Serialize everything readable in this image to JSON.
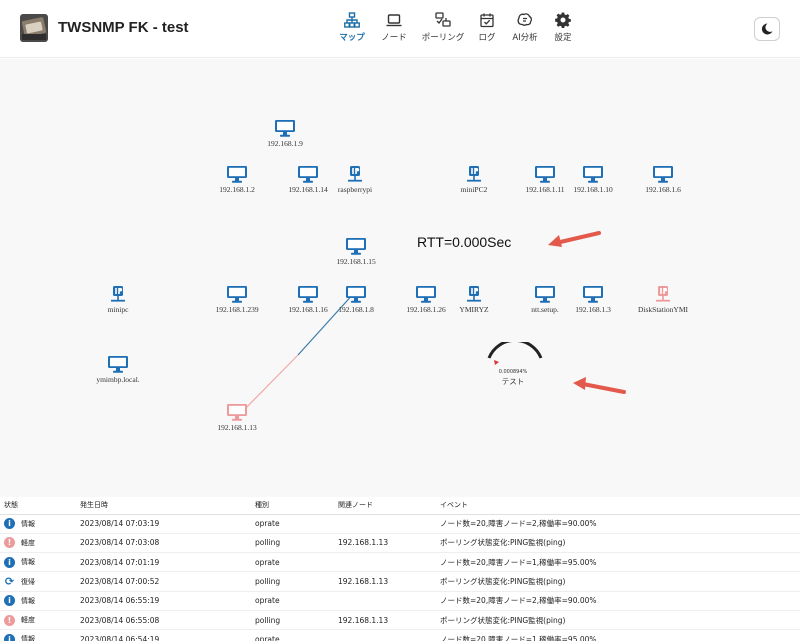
{
  "app": {
    "title": "TWSNMP FK - test"
  },
  "nav": [
    {
      "label": "マップ",
      "icon": "network-map-icon",
      "active": true
    },
    {
      "label": "ノード",
      "icon": "laptop-icon",
      "active": false
    },
    {
      "label": "ポーリング",
      "icon": "polling-icon",
      "active": false
    },
    {
      "label": "ログ",
      "icon": "calendar-check-icon",
      "active": false
    },
    {
      "label": "AI分析",
      "icon": "ai-brain-icon",
      "active": false
    },
    {
      "label": "設定",
      "icon": "gear-icon",
      "active": false
    }
  ],
  "theme_toggle_icon": "moon-icon",
  "colors": {
    "normal": "#1e6fb5",
    "low": "#ef9a9a",
    "alert_arrow": "#e35a4c"
  },
  "map": {
    "nodes": [
      {
        "label": "192.168.1.9",
        "icon": "desktop-icon",
        "state": "normal"
      },
      {
        "label": "192.168.1.2",
        "icon": "desktop-icon",
        "state": "normal"
      },
      {
        "label": "192.168.1.14",
        "icon": "desktop-icon",
        "state": "normal"
      },
      {
        "label": "raspberrypi",
        "icon": "ip-icon",
        "state": "normal"
      },
      {
        "label": "miniPC2",
        "icon": "ip-icon",
        "state": "normal"
      },
      {
        "label": "192.168.1.11",
        "icon": "desktop-icon",
        "state": "normal"
      },
      {
        "label": "192.168.1.10",
        "icon": "desktop-icon",
        "state": "normal"
      },
      {
        "label": "192.168.1.6",
        "icon": "desktop-icon",
        "state": "normal"
      },
      {
        "label": "192.168.1.15",
        "icon": "desktop-icon",
        "state": "normal"
      },
      {
        "label": "minipc",
        "icon": "ip-icon",
        "state": "normal"
      },
      {
        "label": "192.168.1.239",
        "icon": "desktop-icon",
        "state": "normal"
      },
      {
        "label": "192.168.1.16",
        "icon": "desktop-icon",
        "state": "normal"
      },
      {
        "label": "192.168.1.8",
        "icon": "desktop-icon",
        "state": "normal"
      },
      {
        "label": "192.168.1.26",
        "icon": "desktop-icon",
        "state": "normal"
      },
      {
        "label": "YMIRYZ",
        "icon": "ip-icon",
        "state": "normal"
      },
      {
        "label": "ntt.setup.",
        "icon": "desktop-icon",
        "state": "normal"
      },
      {
        "label": "192.168.1.3",
        "icon": "desktop-icon",
        "state": "normal"
      },
      {
        "label": "DiskStationYMI",
        "icon": "ip-icon",
        "state": "low"
      },
      {
        "label": "ymimbp.local.",
        "icon": "desktop-icon",
        "state": "normal"
      },
      {
        "label": "192.168.1.13",
        "icon": "desktop-icon",
        "state": "low"
      }
    ],
    "rtt_text": "RTT=0.000Sec",
    "gauge": {
      "value_text": "0.000894%",
      "name": "テスト",
      "level": 0.0
    }
  },
  "events": {
    "headers": [
      "状態",
      "発生日時",
      "種別",
      "関連ノード",
      "イベント"
    ],
    "rows": [
      {
        "state": "情報",
        "state_type": "info",
        "time": "2023/08/14 07:03:19",
        "type": "oprate",
        "node": "",
        "event": "ノード数=20,障害ノード=2,稼働率=90.00%"
      },
      {
        "state": "軽度",
        "state_type": "low",
        "time": "2023/08/14 07:03:08",
        "type": "polling",
        "node": "192.168.1.13",
        "event": "ポーリング状態変化:PING監視(ping)"
      },
      {
        "state": "情報",
        "state_type": "info",
        "time": "2023/08/14 07:01:19",
        "type": "oprate",
        "node": "",
        "event": "ノード数=20,障害ノード=1,稼働率=95.00%"
      },
      {
        "state": "復帰",
        "state_type": "repair",
        "time": "2023/08/14 07:00:52",
        "type": "polling",
        "node": "192.168.1.13",
        "event": "ポーリング状態変化:PING監視(ping)"
      },
      {
        "state": "情報",
        "state_type": "info",
        "time": "2023/08/14 06:55:19",
        "type": "oprate",
        "node": "",
        "event": "ノード数=20,障害ノード=2,稼働率=90.00%"
      },
      {
        "state": "軽度",
        "state_type": "low",
        "time": "2023/08/14 06:55:08",
        "type": "polling",
        "node": "192.168.1.13",
        "event": "ポーリング状態変化:PING監視(ping)"
      },
      {
        "state": "情報",
        "state_type": "info",
        "time": "2023/08/14 06:54:19",
        "type": "oprate",
        "node": "",
        "event": "ノード数=20,障害ノード=1,稼働率=95.00%"
      }
    ]
  }
}
